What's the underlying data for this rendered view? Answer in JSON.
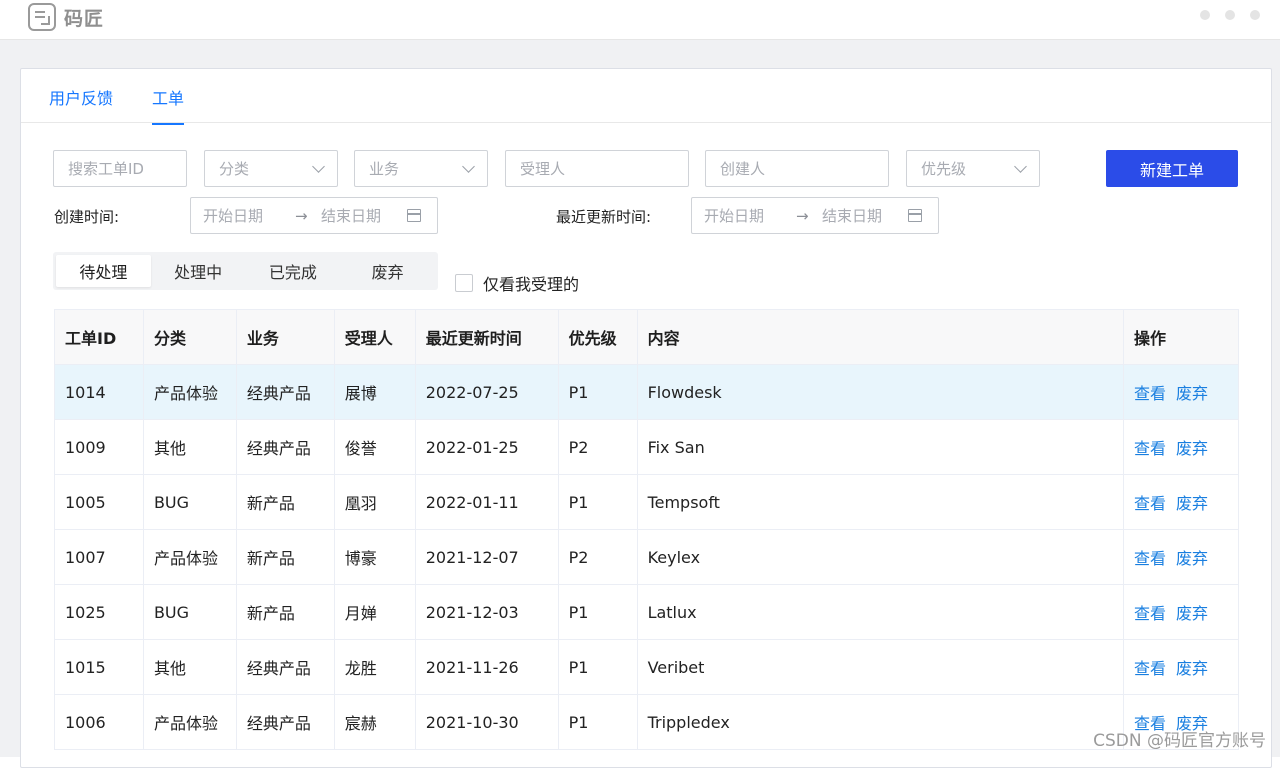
{
  "app": {
    "logo_text": "码匠"
  },
  "tabs": [
    {
      "label": "用户反馈",
      "active": false
    },
    {
      "label": "工单",
      "active": true
    }
  ],
  "filters": {
    "search_placeholder": "搜索工单ID",
    "category_placeholder": "分类",
    "business_placeholder": "业务",
    "assignee_placeholder": "受理人",
    "creator_placeholder": "创建人",
    "priority_placeholder": "优先级",
    "new_button": "新建工单",
    "created_label": "创建时间:",
    "updated_label": "最近更新时间:",
    "start_date": "开始日期",
    "end_date": "结束日期",
    "arrow": "→"
  },
  "status_tabs": [
    "待处理",
    "处理中",
    "已完成",
    "废弃"
  ],
  "only_mine_label": "仅看我受理的",
  "table": {
    "columns": [
      "工单ID",
      "分类",
      "业务",
      "受理人",
      "最近更新时间",
      "优先级",
      "内容",
      "操作"
    ],
    "rows": [
      [
        "1014",
        "产品体验",
        "经典产品",
        "展博",
        "2022-07-25",
        "P1",
        "Flowdesk"
      ],
      [
        "1009",
        "其他",
        "经典产品",
        "俊誉",
        "2022-01-25",
        "P2",
        "Fix San"
      ],
      [
        "1005",
        "BUG",
        "新产品",
        "凰羽",
        "2022-01-11",
        "P1",
        "Tempsoft"
      ],
      [
        "1007",
        "产品体验",
        "新产品",
        "博豪",
        "2021-12-07",
        "P2",
        "Keylex"
      ],
      [
        "1025",
        "BUG",
        "新产品",
        "月婵",
        "2021-12-03",
        "P1",
        "Latlux"
      ],
      [
        "1015",
        "其他",
        "经典产品",
        "龙胜",
        "2021-11-26",
        "P1",
        "Veribet"
      ],
      [
        "1006",
        "产品体验",
        "经典产品",
        "宸赫",
        "2021-10-30",
        "P1",
        "Trippledex"
      ]
    ],
    "actions": {
      "view": "查看",
      "discard": "废弃"
    }
  },
  "watermark": "CSDN @码匠官方账号",
  "colors": {
    "primary": "#2b4ce8",
    "link": "#1a7fe0",
    "highlight_row": "#e8f5fc"
  }
}
